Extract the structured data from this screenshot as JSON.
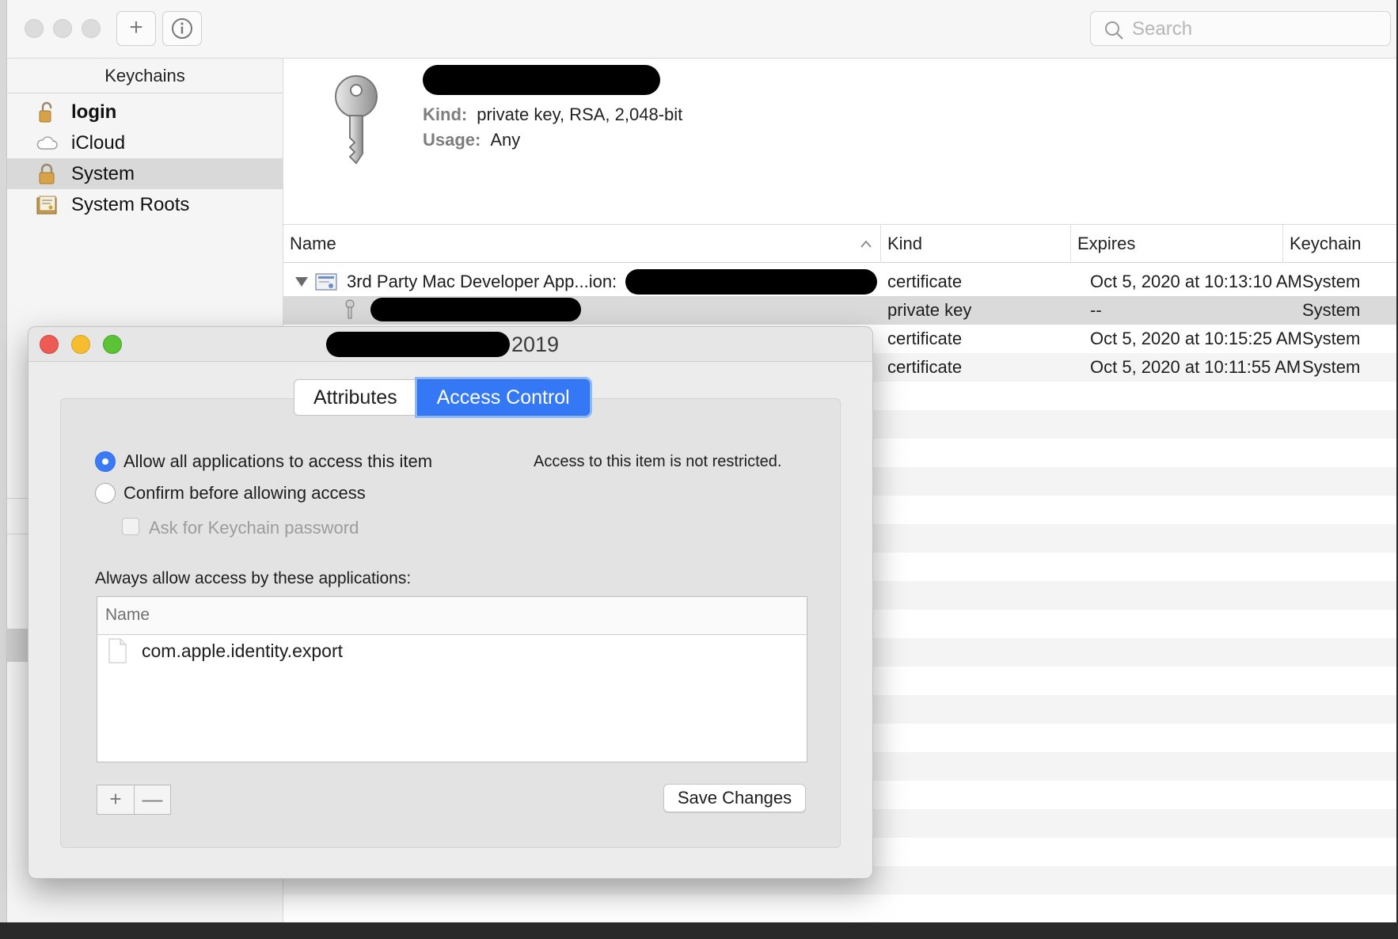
{
  "toolbar": {
    "add_label": "+",
    "info_label": "i",
    "search_placeholder": "Search"
  },
  "sidebar": {
    "header": "Keychains",
    "items": [
      {
        "label": "login",
        "icon": "unlocked-padlock-icon"
      },
      {
        "label": "iCloud",
        "icon": "cloud-icon"
      },
      {
        "label": "System",
        "icon": "locked-padlock-icon"
      },
      {
        "label": "System Roots",
        "icon": "certificate-folder-icon"
      }
    ],
    "selected_index": 2
  },
  "info": {
    "icon": "key-icon",
    "kind_label": "Kind:",
    "kind_value": "private key, RSA, 2,048-bit",
    "usage_label": "Usage:",
    "usage_value": "Any"
  },
  "table": {
    "columns": [
      "Name",
      "Kind",
      "Expires",
      "Keychain"
    ],
    "sort_icon": "sort-ascending-icon",
    "rows": [
      {
        "name": "3rd Party Mac Developer App...ion:",
        "kind": "certificate",
        "expires": "Oct 5, 2020 at 10:13:10 AM",
        "keychain": "System",
        "icon": "certificate-icon",
        "expanded": true
      },
      {
        "name": "",
        "kind": "private key",
        "expires": "--",
        "keychain": "System",
        "icon": "small-key-icon",
        "selected": true
      },
      {
        "name": "",
        "kind": "certificate",
        "expires": "Oct 5, 2020 at 10:15:25 AM",
        "keychain": "System"
      },
      {
        "name": "",
        "kind": "certificate",
        "expires": "Oct 5, 2020 at 10:11:55 AM",
        "keychain": "System"
      }
    ]
  },
  "dialog": {
    "title_suffix": "2019",
    "tabs": [
      "Attributes",
      "Access Control"
    ],
    "active_tab": 1,
    "radio_allow_all": "Allow all applications to access this item",
    "radio_confirm": "Confirm before allowing access",
    "ask_password": "Ask for Keychain password",
    "status_note": "Access to this item is not restricted.",
    "always_allow_label": "Always allow access by these applications:",
    "app_list_header": "Name",
    "apps": [
      "com.apple.identity.export"
    ],
    "add_label": "+",
    "remove_label": "—",
    "save_label": "Save Changes"
  },
  "colors": {
    "accent": "#3478f6",
    "close": "#ee5b55",
    "minimize": "#f5bd2f",
    "zoom": "#5cc337",
    "redaction": "#000000"
  }
}
